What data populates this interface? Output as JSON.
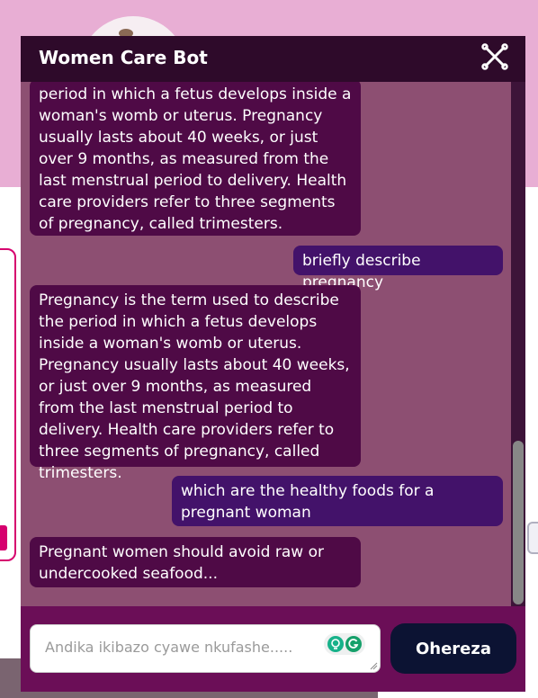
{
  "chat": {
    "title": "Women Care Bot",
    "messages": [
      {
        "role": "bot",
        "text": "period in which a fetus develops inside a woman's womb or uterus. Pregnancy usually lasts about 40 weeks, or just over 9 months, as measured from the last menstrual period to delivery. Health care providers refer to three segments of pregnancy, called trimesters."
      },
      {
        "role": "user",
        "text": "briefly describe pregnancy"
      },
      {
        "role": "bot",
        "text": "Pregnancy is the term used to describe the period in which a fetus develops inside a woman's womb or uterus. Pregnancy usually lasts about 40 weeks, or just over 9 months, as measured from the last menstrual period to delivery. Health care providers refer to three segments of pregnancy, called trimesters."
      },
      {
        "role": "user",
        "text": "which are the healthy foods for a pregnant woman"
      },
      {
        "role": "bot",
        "text": "Pregnant women should avoid raw or undercooked seafood..."
      }
    ],
    "input_placeholder": "Andika ikibazo cyawe nkufashe.....",
    "input_value": "",
    "send_label": "Ohereza"
  },
  "icons": {
    "close": "close-x-icon",
    "grammarly_left": "bulb-icon",
    "grammarly_right": "grammarly-g-icon"
  },
  "colors": {
    "header_bg": "#2e0a2a",
    "messages_bg": "#8d4f72",
    "bot_bubble": "#4f0a46",
    "user_bubble": "#43126a",
    "input_area_bg": "#6b0e57",
    "send_button_bg": "#0c1333",
    "page_top_bg": "#e8aed4"
  }
}
